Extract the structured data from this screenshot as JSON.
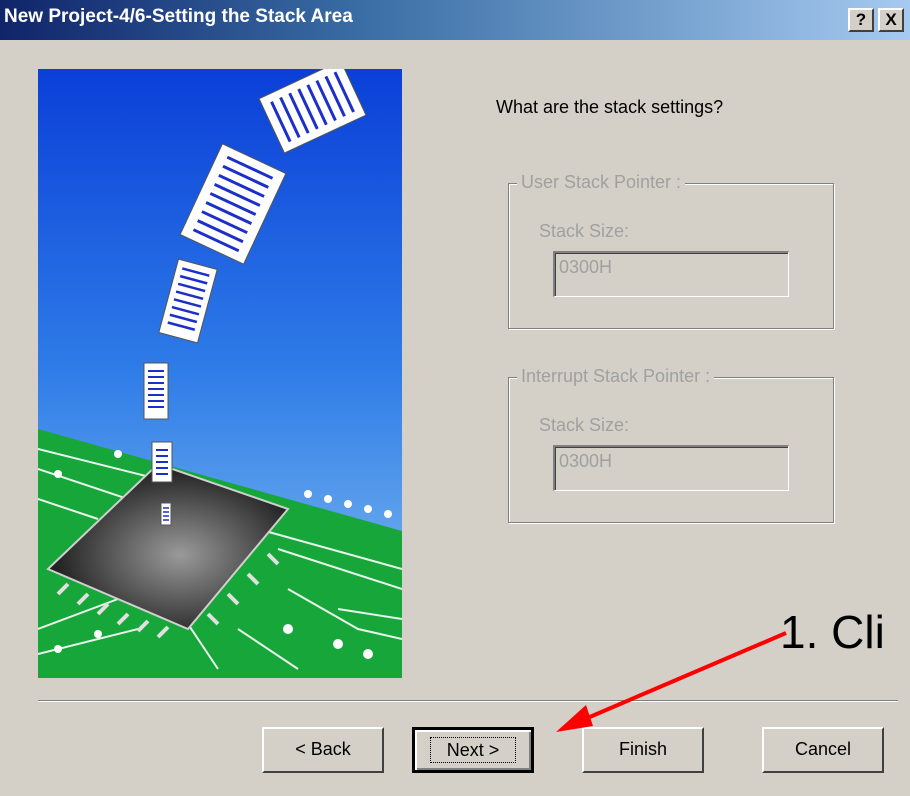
{
  "window": {
    "title": "New Project-4/6-Setting the Stack Area",
    "help_label": "?",
    "close_label": "X"
  },
  "main": {
    "prompt": "What are the stack settings?",
    "user_stack": {
      "legend": "User Stack Pointer :",
      "label": "Stack Size:",
      "value": "0300H"
    },
    "interrupt_stack": {
      "legend": "Interrupt Stack Pointer :",
      "label": "Stack Size:",
      "value": "0300H"
    }
  },
  "buttons": {
    "back": "< Back",
    "next": "Next >",
    "finish": "Finish",
    "cancel": "Cancel"
  },
  "annotation": {
    "text": "1. Cli",
    "arrow_color": "#ff0000"
  }
}
